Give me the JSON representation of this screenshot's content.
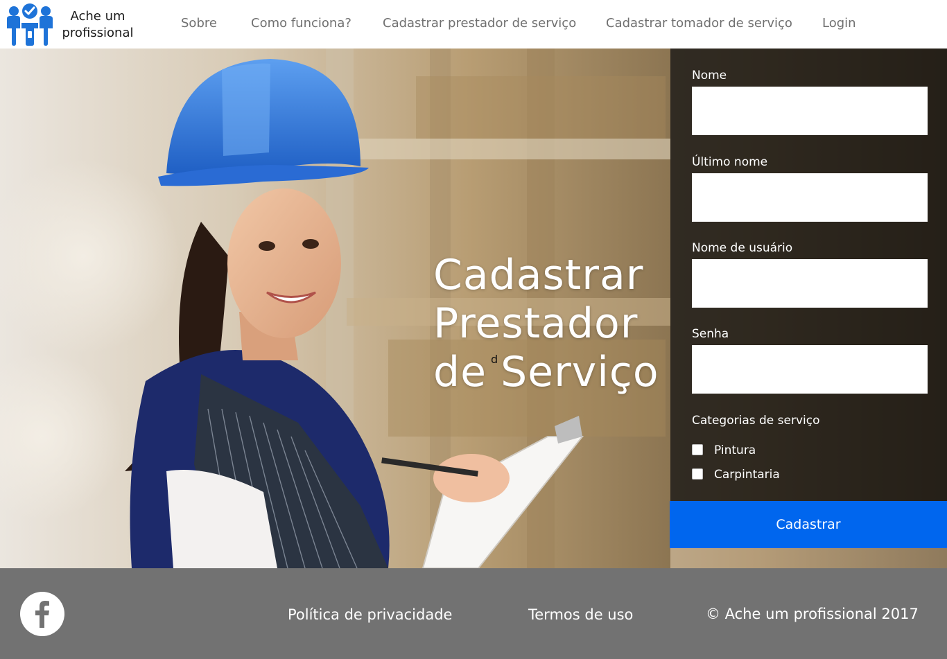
{
  "brand": {
    "name_line1": "Ache um",
    "name_line2": "profissional",
    "colors": {
      "primary": "#0066ee",
      "logo_blue": "#1e73d8"
    }
  },
  "nav": {
    "items": [
      {
        "label": "Sobre"
      },
      {
        "label": "Como funciona?"
      },
      {
        "label": "Cadastrar prestador de serviço"
      },
      {
        "label": "Cadastrar tomador de serviço"
      },
      {
        "label": "Login"
      }
    ]
  },
  "hero": {
    "title_line1": "Cadastrar",
    "title_line2": "Prestador",
    "title_line3": "de Serviço",
    "stray_text": "d",
    "image": "woman-in-blue-hard-hat-with-clipboard"
  },
  "form": {
    "fields": [
      {
        "label": "Nome",
        "value": "",
        "placeholder": ""
      },
      {
        "label": "Último nome",
        "value": "",
        "placeholder": ""
      },
      {
        "label": "Nome de usuário",
        "value": "",
        "placeholder": ""
      },
      {
        "label": "Senha",
        "value": "",
        "placeholder": ""
      }
    ],
    "categories_label": "Categorias de serviço",
    "categories": [
      {
        "label": "Pintura",
        "checked": false
      },
      {
        "label": "Carpintaria",
        "checked": false
      }
    ],
    "submit_label": "Cadastrar"
  },
  "footer": {
    "social_icon": "facebook-icon",
    "privacy_label": "Política de privacidade",
    "terms_label": "Termos de uso",
    "copyright": "© Ache um profissional 2017"
  }
}
